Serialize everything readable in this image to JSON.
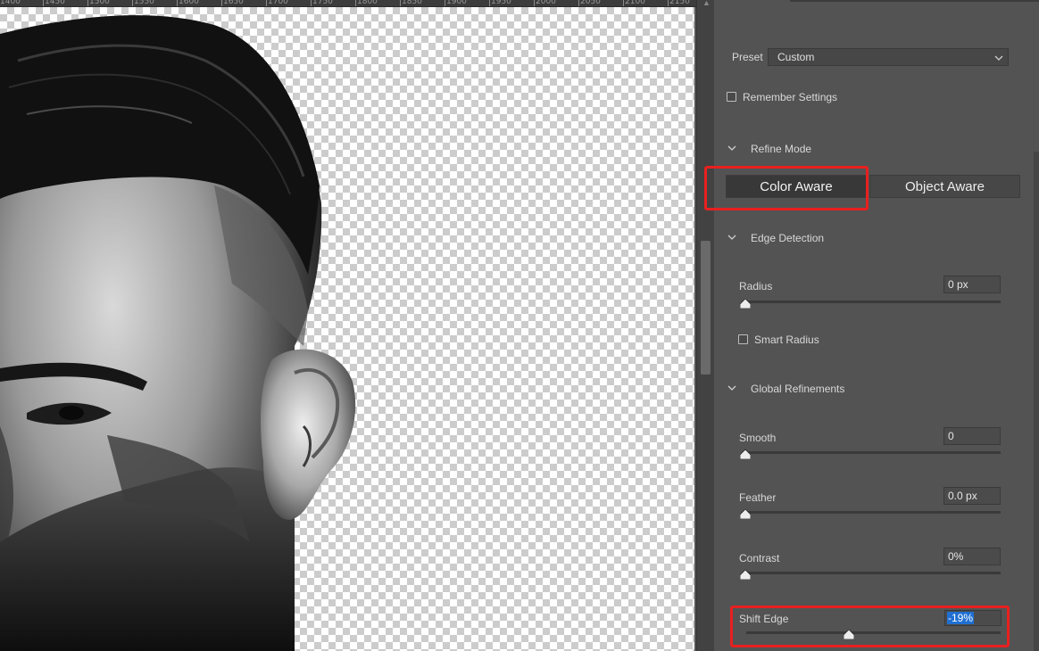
{
  "ruler": {
    "ticks": [
      "1400",
      "1450",
      "1500",
      "1550",
      "1600",
      "1650",
      "1700",
      "1750",
      "1800",
      "1850",
      "1900",
      "1950",
      "2000",
      "2050",
      "2100",
      "2150"
    ]
  },
  "panel": {
    "preset_label": "Preset",
    "preset_value": "Custom",
    "remember_settings": {
      "label": "Remember Settings",
      "checked": false
    },
    "refine_mode": {
      "title": "Refine Mode",
      "options": [
        "Color Aware",
        "Object Aware"
      ],
      "selected": "Color Aware"
    },
    "edge_detection": {
      "title": "Edge Detection",
      "radius": {
        "label": "Radius",
        "value": "0 px",
        "level": 0
      },
      "smart_radius": {
        "label": "Smart Radius",
        "checked": false
      }
    },
    "global_refinements": {
      "title": "Global Refinements",
      "smooth": {
        "label": "Smooth",
        "value": "0",
        "level": 0
      },
      "feather": {
        "label": "Feather",
        "value": "0.0 px",
        "level": 0
      },
      "contrast": {
        "label": "Contrast",
        "value": "0%",
        "level": 0
      },
      "shift_edge": {
        "label": "Shift Edge",
        "value": "-19%",
        "level": -19
      }
    }
  },
  "annotations": {
    "highlight_color": "#e82020"
  },
  "colors": {
    "panel_bg": "#535353",
    "selection_blue": "#1f6fd1"
  }
}
